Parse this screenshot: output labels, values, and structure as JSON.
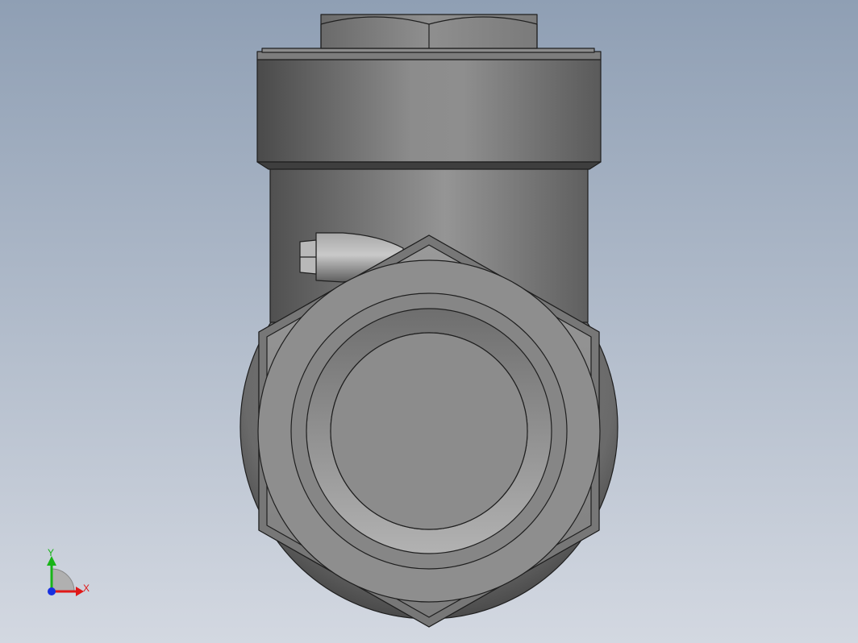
{
  "view": {
    "background_top": "#8f9fb4",
    "background_bottom": "#d3d8e1"
  },
  "part": {
    "body_color": "#8a8a8a",
    "edge_color": "#1f1f1f"
  },
  "triad": {
    "x_label": "X",
    "y_label": "Y",
    "x_color": "#e01818",
    "y_color": "#18b418",
    "z_color": "#1830e0"
  }
}
